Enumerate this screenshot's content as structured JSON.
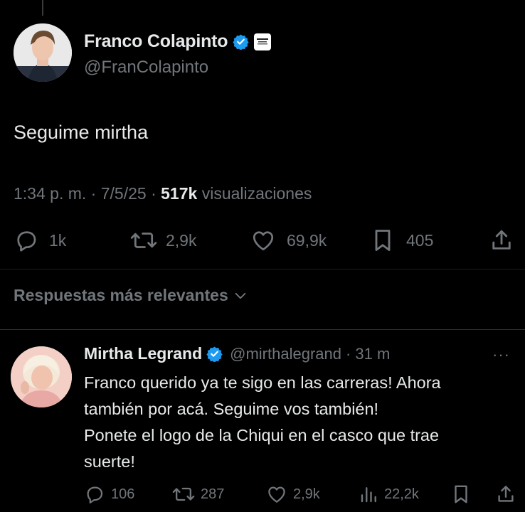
{
  "main_post": {
    "display_name": "Franco Colapinto",
    "handle": "@FranColapinto",
    "text": "Seguime mirtha",
    "time": "1:34 p. m.",
    "date": "7/5/25",
    "views_count": "517k",
    "views_label": "visualizaciones",
    "separator": "·",
    "replies": "1k",
    "reposts": "2,9k",
    "likes": "69,9k",
    "bookmarks": "405"
  },
  "sort_label": "Respuestas más relevantes",
  "reply": {
    "display_name": "Mirtha Legrand",
    "handle": "@mirthalegrand",
    "time": "· 31 m",
    "more": "···",
    "text_lines": [
      "Franco querido ya te sigo en las carreras! Ahora",
      "también por acá. Seguime vos también!",
      "Ponete el logo de la Chiqui en el casco que trae",
      "suerte!"
    ],
    "replies": "106",
    "reposts": "287",
    "likes": "2,9k",
    "views": "22,2k"
  },
  "colors": {
    "background": "#000000",
    "text_primary": "#e7e9ea",
    "text_secondary": "#71767b",
    "verified": "#1d9bf0"
  },
  "icons": [
    "reply-icon",
    "repost-icon",
    "like-icon",
    "bookmark-icon",
    "share-icon",
    "views-icon",
    "verified-badge-icon",
    "chevron-down-icon",
    "more-icon"
  ]
}
